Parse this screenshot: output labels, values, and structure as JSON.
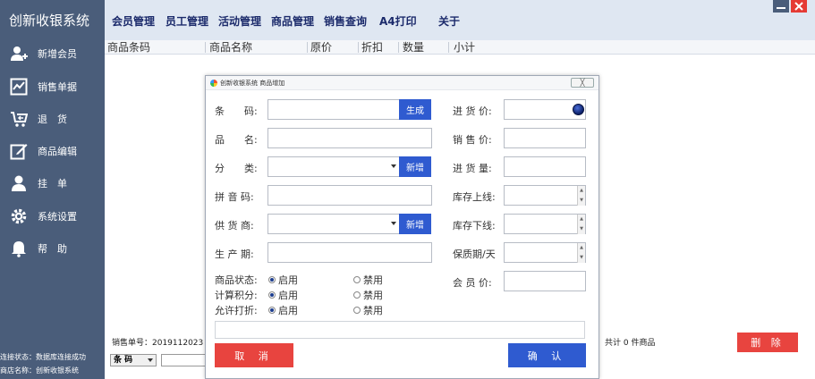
{
  "sidebar": {
    "brand": "创新收银系统",
    "items": [
      {
        "label": "新增会员",
        "icon": "add-user-icon"
      },
      {
        "label": "销售单据",
        "icon": "chart-line-icon"
      },
      {
        "label": "退　货",
        "icon": "cart-return-icon"
      },
      {
        "label": "商品编辑",
        "icon": "edit-icon"
      },
      {
        "label": "挂　单",
        "icon": "user-icon"
      },
      {
        "label": "系统设置",
        "icon": "gear-icon"
      },
      {
        "label": "帮　助",
        "icon": "bell-icon"
      }
    ],
    "status_connection": "连接状态：数据库连接成功",
    "status_store": "商店名称：创新收银系统"
  },
  "menu": [
    "会员管理",
    "员工管理",
    "活动管理",
    "商品管理",
    "销售查询",
    "A4打印",
    "关于"
  ],
  "table": {
    "columns": [
      "商品条码",
      "商品名称",
      "原价",
      "折扣",
      "数量",
      "小计"
    ]
  },
  "footer": {
    "order_no": "销售单号：2019112023",
    "total": "共计 0 件商品",
    "barcode_select": "条 码",
    "delete_label": "删 除"
  },
  "dialog": {
    "title": "创新收银系统 商品增加",
    "close": "╳",
    "left_fields": {
      "barcode": "条　　码:",
      "name": "品　　名:",
      "category": "分　　类:",
      "pinyin": "拼 音 码:",
      "supplier": "供 货 商:",
      "production_date": "生 产 期:"
    },
    "right_fields": {
      "purchase_price": "进 货 价:",
      "sale_price": "销 售 价:",
      "purchase_qty": "进 货 量:",
      "stock_upper": "库存上线:",
      "stock_lower": "库存下线:",
      "shelf_life": "保质期/天",
      "member_price": "会 员 价:"
    },
    "generate_label": "生成",
    "new_label_1": "新增",
    "new_label_2": "新增",
    "radios": {
      "status_label": "商品状态:",
      "points_label": "计算积分:",
      "discount_label": "允许打折:",
      "enable": "启用",
      "disable": "禁用"
    },
    "cancel_label": "取 消",
    "ok_label": "确 认"
  },
  "colors": {
    "sidebar": "#4a5d7a",
    "topbar": "#dfe7f2",
    "primary_blue": "#2f5bd0",
    "danger_red": "#e8443f"
  }
}
